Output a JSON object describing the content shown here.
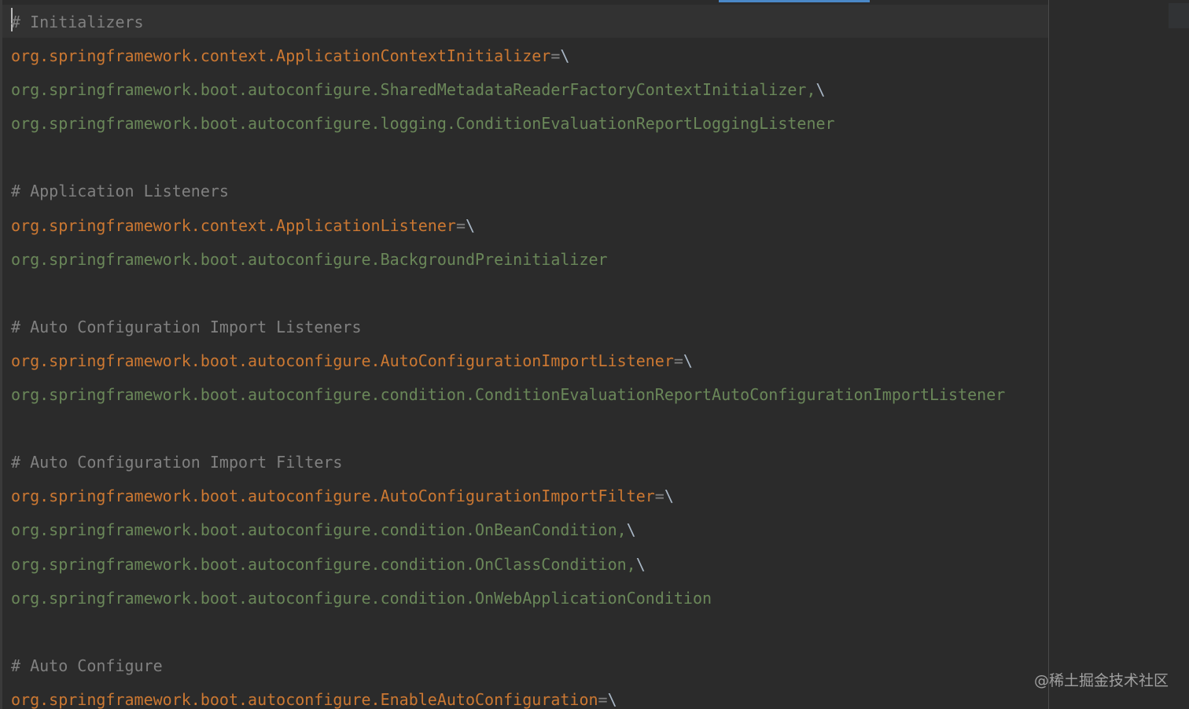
{
  "editor": {
    "lines": [
      {
        "type": "comment",
        "text": "# Initializers"
      },
      {
        "type": "key",
        "key": "org.springframework.context.ApplicationContextInitializer",
        "op": "=",
        "cont": "\\"
      },
      {
        "type": "value",
        "value": "org.springframework.boot.autoconfigure.SharedMetadataReaderFactoryContextInitializer,",
        "cont": "\\"
      },
      {
        "type": "value",
        "value": "org.springframework.boot.autoconfigure.logging.ConditionEvaluationReportLoggingListener",
        "cont": ""
      },
      {
        "type": "blank"
      },
      {
        "type": "comment",
        "text": "# Application Listeners"
      },
      {
        "type": "key",
        "key": "org.springframework.context.ApplicationListener",
        "op": "=",
        "cont": "\\"
      },
      {
        "type": "value",
        "value": "org.springframework.boot.autoconfigure.BackgroundPreinitializer",
        "cont": ""
      },
      {
        "type": "blank"
      },
      {
        "type": "comment",
        "text": "# Auto Configuration Import Listeners"
      },
      {
        "type": "key",
        "key": "org.springframework.boot.autoconfigure.AutoConfigurationImportListener",
        "op": "=",
        "cont": "\\"
      },
      {
        "type": "value",
        "value": "org.springframework.boot.autoconfigure.condition.ConditionEvaluationReportAutoConfigurationImportListener",
        "cont": ""
      },
      {
        "type": "blank"
      },
      {
        "type": "comment",
        "text": "# Auto Configuration Import Filters"
      },
      {
        "type": "key",
        "key": "org.springframework.boot.autoconfigure.AutoConfigurationImportFilter",
        "op": "=",
        "cont": "\\"
      },
      {
        "type": "value",
        "value": "org.springframework.boot.autoconfigure.condition.OnBeanCondition,",
        "cont": "\\"
      },
      {
        "type": "value",
        "value": "org.springframework.boot.autoconfigure.condition.OnClassCondition,",
        "cont": "\\"
      },
      {
        "type": "value",
        "value": "org.springframework.boot.autoconfigure.condition.OnWebApplicationCondition",
        "cont": ""
      },
      {
        "type": "blank"
      },
      {
        "type": "comment",
        "text": "# Auto Configure"
      },
      {
        "type": "key",
        "key": "org.springframework.boot.autoconfigure.EnableAutoConfiguration",
        "op": "=",
        "cont": "\\"
      }
    ]
  },
  "watermark": "@稀土掘金技术社区",
  "colors": {
    "background": "#2b2b2b",
    "comment": "#808080",
    "key": "#cc7832",
    "value": "#6a8759",
    "continuation": "#a9b7c6",
    "progress": "#4a88c7"
  }
}
